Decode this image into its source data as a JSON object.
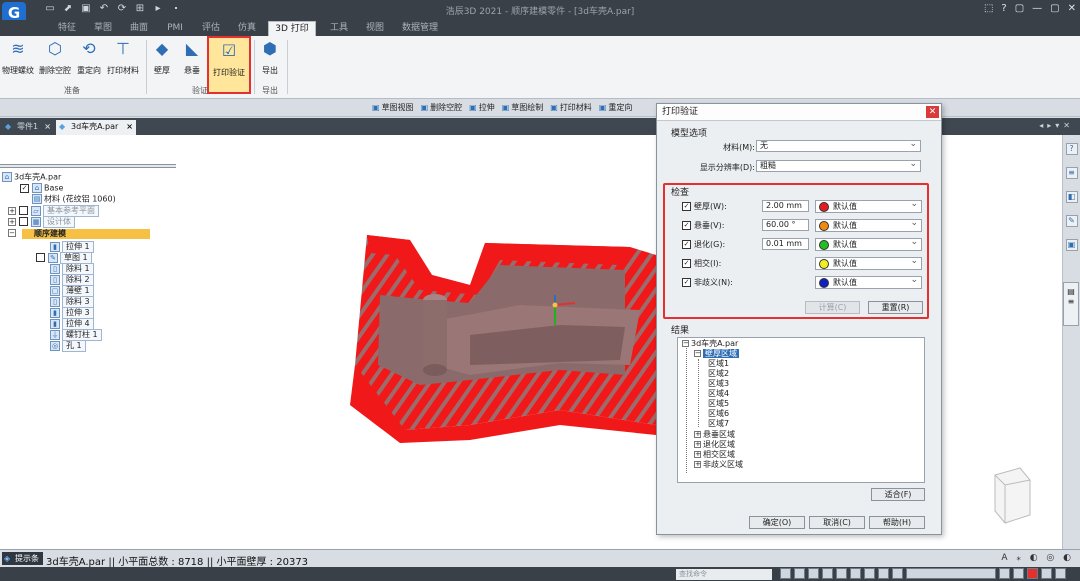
{
  "app": {
    "title": "浩辰3D 2021 - 顺序建模零件 - [3d车壳A.par]",
    "logo": "G"
  },
  "quick_access": [
    "▭",
    "⬈",
    "▣",
    "↶",
    "⟳",
    "⊞",
    "▸",
    "⬝"
  ],
  "window_buttons": [
    "⬚",
    "?",
    "▢",
    "—",
    "▢",
    "✕"
  ],
  "ribbon_tabs": [
    "特征",
    "草图",
    "曲面",
    "PMI",
    "评估",
    "仿真",
    "3D 打印",
    "工具",
    "视图",
    "数据管理"
  ],
  "ribbon": {
    "buttons": [
      {
        "label": "物理螺纹",
        "icon": "≋"
      },
      {
        "label": "删除空腔",
        "icon": "⬡"
      },
      {
        "label": "重定向",
        "icon": "⟲"
      },
      {
        "label": "打印材料",
        "icon": "⊤"
      },
      {
        "label": "壁厚",
        "icon": "◆"
      },
      {
        "label": "悬垂",
        "icon": "◣"
      },
      {
        "label": "打印验证",
        "icon": "☑"
      },
      {
        "label": "导出",
        "icon": "⬢"
      }
    ],
    "groups": [
      "准备",
      "验证",
      "导出"
    ]
  },
  "subtoolbar": [
    "草图视图",
    "删除空腔",
    "拉伸",
    "草图绘制",
    "打印材料",
    "重定向"
  ],
  "doc_tabs": [
    {
      "label": "零件1"
    },
    {
      "label": "3d车壳A.par"
    }
  ],
  "tree": {
    "root": "3d车壳A.par",
    "base": "Base",
    "material": "材料 (花纹铝 1060)",
    "ref_planes": "基本参考平面",
    "design_body": "设计体",
    "sequence": "顺序建模",
    "features": [
      "拉伸 1",
      "草图 1",
      "除料 1",
      "除料 2",
      "薄壁 1",
      "除料 3",
      "拉伸 3",
      "拉伸 4",
      "螺钉柱 1",
      "孔 1"
    ]
  },
  "status": {
    "label": "提示条",
    "text": "3d车壳A.par || 小平面总数 : 8718 || 小平面壁厚 : 20373",
    "command_placeholder": "查找命令"
  },
  "dialog": {
    "title": "打印验证",
    "model_options_title": "模型选项",
    "material_label": "材料(M):",
    "material_value": "无",
    "resolution_label": "显示分辨率(D):",
    "resolution_value": "粗糙",
    "check_title": "检查",
    "checks": [
      {
        "name": "壁厚(W):",
        "value": "2.00 mm",
        "color_name": "默认值",
        "color": "#e02020"
      },
      {
        "name": "悬垂(V):",
        "value": "60.00 °",
        "color_name": "默认值",
        "color": "#f08a10"
      },
      {
        "name": "退化(G):",
        "value": "0.01 mm",
        "color_name": "默认值",
        "color": "#20c020"
      },
      {
        "name": "相交(I):",
        "value": "",
        "color_name": "默认值",
        "color": "#f0f020"
      },
      {
        "name": "非歧义(N):",
        "value": "",
        "color_name": "默认值",
        "color": "#1020c0"
      }
    ],
    "calc_button": "计算(C)",
    "reset_button": "重置(R)",
    "results_title": "结果",
    "results": {
      "root": "3d车壳A.par",
      "wall_regions": "壁厚区域",
      "regions": [
        "区域1",
        "区域2",
        "区域3",
        "区域4",
        "区域5",
        "区域6",
        "区域7"
      ],
      "others": [
        "悬垂区域",
        "退化区域",
        "相交区域",
        "非歧义区域"
      ]
    },
    "fit_button": "适合(F)",
    "ok_button": "确定(O)",
    "cancel_button": "取消(C)",
    "help_button": "帮助(H)"
  },
  "colors": {
    "highlight": "#e53030",
    "model_red": "#f01818",
    "model_gray": "#8a6a6a",
    "accent_blue": "#2f6db5"
  }
}
